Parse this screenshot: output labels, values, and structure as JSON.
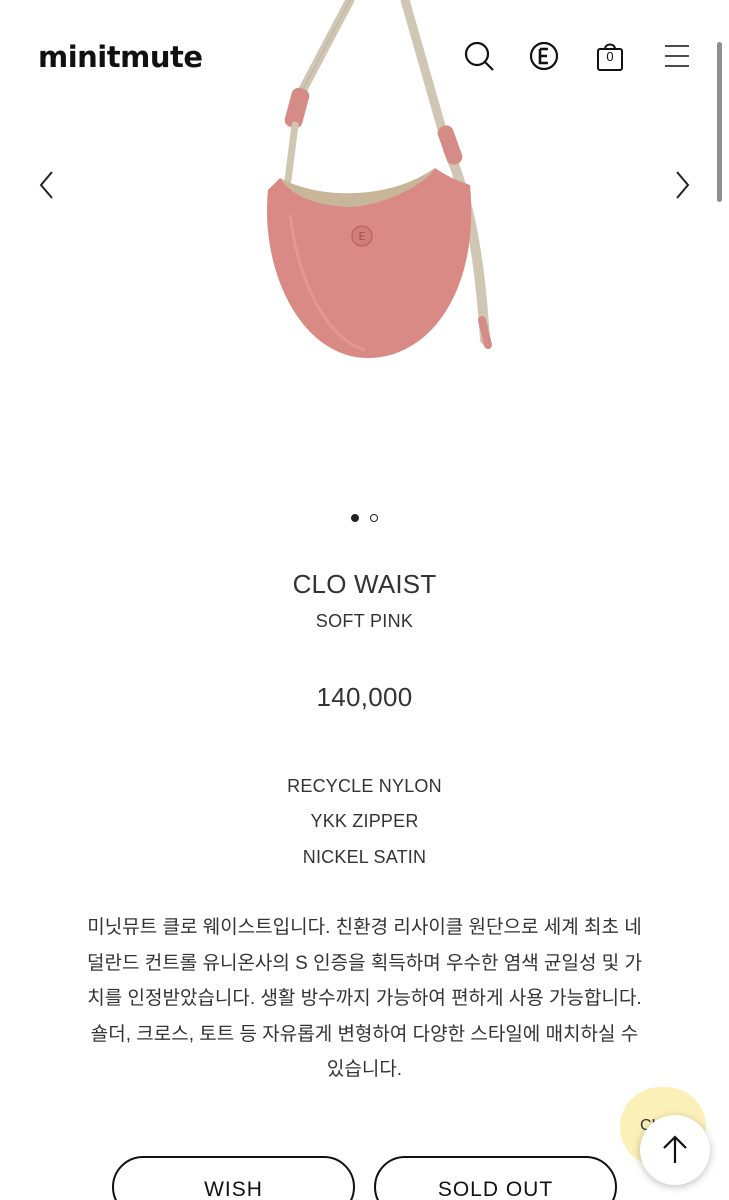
{
  "header": {
    "logo": "minitmute",
    "cart_count": "0",
    "icons": [
      "search-icon",
      "brand-e-icon",
      "cart-icon",
      "menu-icon"
    ]
  },
  "gallery": {
    "image": "pink-crescent-shoulder-bag",
    "total_images": 2,
    "active_index": 1
  },
  "product": {
    "name": "CLO WAIST",
    "color": "SOFT PINK",
    "price": "140,000",
    "specs": [
      "RECYCLE NYLON",
      "YKK ZIPPER",
      "NICKEL SATIN"
    ],
    "description": [
      "미닛뮤트 클로 웨이스트입니다. 친환경 리사이클 원단으로 세계 최초 네",
      "덜란드 컨트롤 유니온사의 S 인증을 획득하며 우수한 염색 균일성 및 가",
      "치를 인정받았습니다. 생활 방수까지 가능하여 편하게 사용 가능합니다.",
      "숄더, 크로스, 토트 등 자유롭게 변형하여 다양한 스타일에 매치하실 수",
      "있습니다."
    ]
  },
  "actions": {
    "wish_label": "WISH",
    "soldout_label": "SOLD OUT",
    "chat_label": "CHA"
  },
  "colors": {
    "bag": "#d98a84",
    "strap": "#cfc7b3",
    "chat_bubble": "#fbf0b7"
  }
}
